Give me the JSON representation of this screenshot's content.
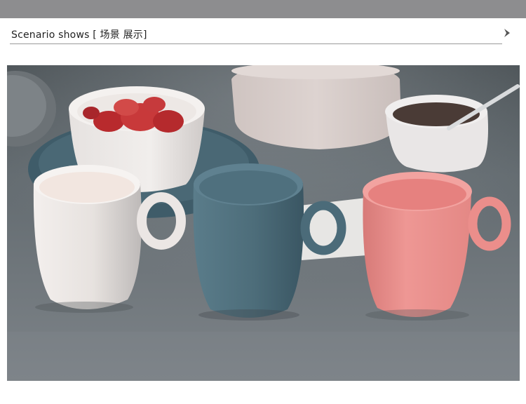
{
  "header": {
    "title": "Scenario shows [ 场景 展示]",
    "chevron_icon": "chevron-right-icon"
  },
  "photo": {
    "subject": "three mugs photo",
    "colors": {
      "background": "#5a6166",
      "white_mug": "#ece8e6",
      "blue_mug": "#50717f",
      "pink_mug": "#eb8f8c"
    }
  }
}
